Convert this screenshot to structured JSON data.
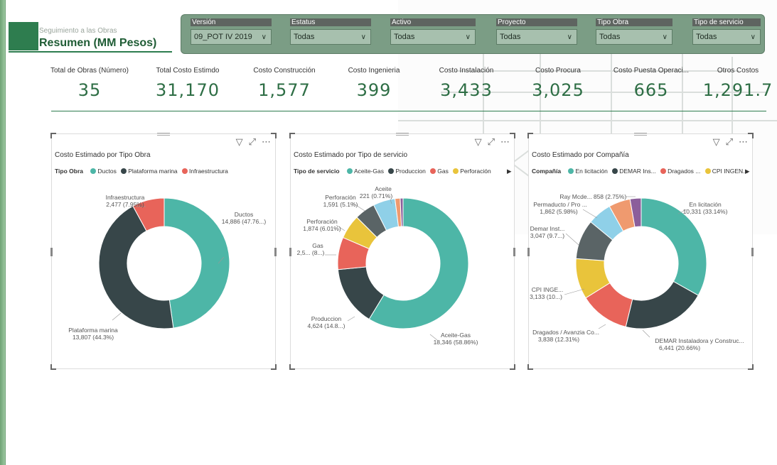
{
  "header": {
    "subtitle": "Seguimiento a las Obras",
    "title": "Resumen (MM Pesos)"
  },
  "filters": [
    {
      "label": "Versión",
      "value": "09_POT IV 2019"
    },
    {
      "label": "Estatus",
      "value": "Todas"
    },
    {
      "label": "Activo",
      "value": "Todas"
    },
    {
      "label": "Proyecto",
      "value": "Todas"
    },
    {
      "label": "Tipo Obra",
      "value": "Todas"
    },
    {
      "label": "Tipo de servicio",
      "value": "Todas"
    }
  ],
  "kpis": [
    {
      "label": "Total de Obras (Número)",
      "value": "35"
    },
    {
      "label": "Total Costo Estimdo",
      "value": "31,170"
    },
    {
      "label": "Costo Construcción",
      "value": "1,577"
    },
    {
      "label": "Costo Ingenieria",
      "value": "399"
    },
    {
      "label": "Costo Instalación",
      "value": "3,433"
    },
    {
      "label": "Costo Procura",
      "value": "3,025"
    },
    {
      "label": "Costo Puesta Operaci...",
      "value": "665"
    },
    {
      "label": "Otros Costos",
      "value": "1,291.7"
    }
  ],
  "colors": {
    "brand": "#2e7d4f",
    "teal": "#4db6a7",
    "dark": "#374649",
    "red": "#e8645a",
    "yellow": "#e9c43b",
    "lightblue": "#8fd0e8",
    "orange": "#ef9a6f",
    "purple": "#8b5e9b"
  },
  "chart_data": [
    {
      "type": "pie",
      "title": "Costo Estimado por Tipo Obra",
      "legend_title": "Tipo Obra",
      "legend_items": [
        "Ductos",
        "Plataforma marina",
        "Infraestructura"
      ],
      "legend_placement": "top",
      "slices": [
        {
          "name": "Ductos",
          "value": 14886,
          "label": "14,886 (47.76...)",
          "color": "#4db6a7"
        },
        {
          "name": "Plataforma marina",
          "value": 13807,
          "label": "13,807 (44.3%)",
          "color": "#374649"
        },
        {
          "name": "Infraestructura",
          "value": 2477,
          "label": "2,477 (7.95%)",
          "color": "#e8645a"
        }
      ]
    },
    {
      "type": "pie",
      "title": "Costo Estimado por Tipo de servicio",
      "legend_title": "Tipo de servicio",
      "legend_items": [
        "Aceite-Gas",
        "Produccion",
        "Gas",
        "Perforación"
      ],
      "legend_placement": "top",
      "slices": [
        {
          "name": "Aceite-Gas",
          "value": 18346,
          "label": "18,346 (58.86%)",
          "color": "#4db6a7"
        },
        {
          "name": "Produccion",
          "value": 4624,
          "label": "4,624 (14.8...)",
          "color": "#374649"
        },
        {
          "name": "Gas",
          "value": 2500,
          "label": "2,5... (8...)",
          "color": "#e8645a"
        },
        {
          "name": "Perforación",
          "value": 1874,
          "label": "1,874 (6.01%)",
          "color": "#e9c43b"
        },
        {
          "name": "Perforación",
          "value": 1591,
          "label": "1,591 (5.1%)",
          "color": "#5a6466"
        },
        {
          "name": "",
          "value": 1700,
          "label": "",
          "color": "#8fd0e8"
        },
        {
          "name": "",
          "value": 400,
          "label": "",
          "color": "#ef9a6f"
        },
        {
          "name": "Aceite",
          "value": 221,
          "label": "221 (0.71%)",
          "color": "#8b5e9b"
        }
      ]
    },
    {
      "type": "pie",
      "title": "Costo Estimado por Compañía",
      "legend_title": "Compañía",
      "legend_items": [
        "En licitación",
        "DEMAR Ins...",
        "Dragados ...",
        "CPI INGEN..."
      ],
      "legend_placement": "top",
      "slices": [
        {
          "name": "En licitación",
          "value": 10331,
          "label": "10,331 (33.14%)",
          "color": "#4db6a7"
        },
        {
          "name": "DEMAR Instaladora y Construc...",
          "value": 6441,
          "label": "6,441 (20.66%)",
          "color": "#374649"
        },
        {
          "name": "Dragados / Avanzia Co...",
          "value": 3838,
          "label": "3,838 (12.31%)",
          "color": "#e8645a"
        },
        {
          "name": "CPI INGE...",
          "value": 3133,
          "label": "3,133 (10...)",
          "color": "#e9c43b"
        },
        {
          "name": "Demar Inst...",
          "value": 3047,
          "label": "3,047 (9.7...)",
          "color": "#5a6466"
        },
        {
          "name": "Permaducto / Pro ...",
          "value": 1862,
          "label": "1,862 (5.98%)",
          "color": "#8fd0e8"
        },
        {
          "name": "",
          "value": 1660,
          "label": "",
          "color": "#ef9a6f"
        },
        {
          "name": "Ray Mcde...",
          "value": 858,
          "label": "858 (2.75%)",
          "color": "#8b5e9b"
        }
      ]
    }
  ]
}
